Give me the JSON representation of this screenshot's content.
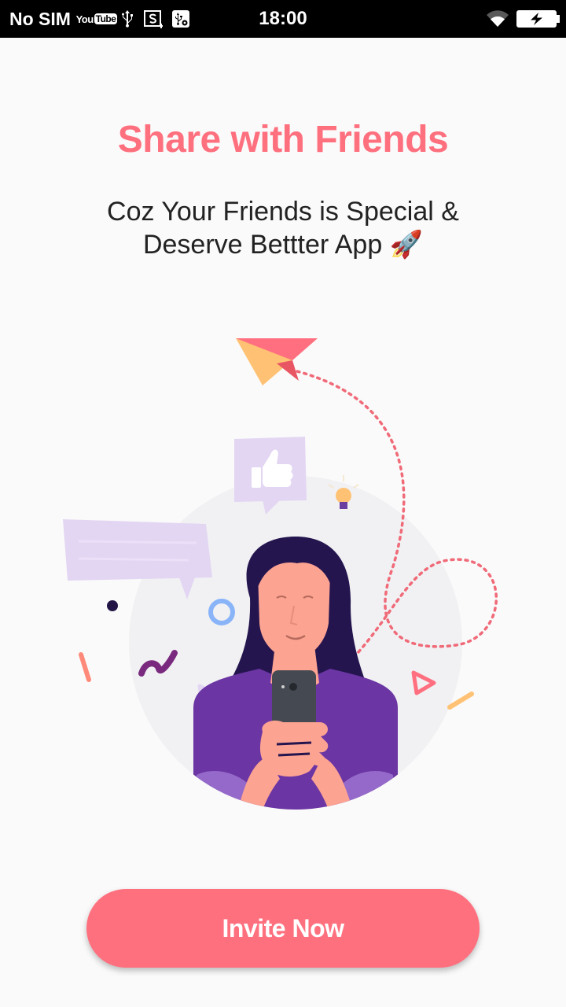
{
  "status_bar": {
    "carrier": "No SIM",
    "time": "18:00",
    "icons": [
      "youtube-icon",
      "usb-icon",
      "screenshot-icon",
      "usb-debug-icon",
      "wifi-icon",
      "battery-charging-icon"
    ]
  },
  "onboarding": {
    "title": "Share with Friends",
    "subtitle_line1": "Coz Your Friends is Special &",
    "subtitle_line2": "Deserve Bettter App 🚀",
    "invite_label": "Invite Now"
  },
  "colors": {
    "accent": "#ff707f",
    "background": "#fafafa",
    "purple": "#6b35a3",
    "lavender": "#e3d6f3"
  }
}
